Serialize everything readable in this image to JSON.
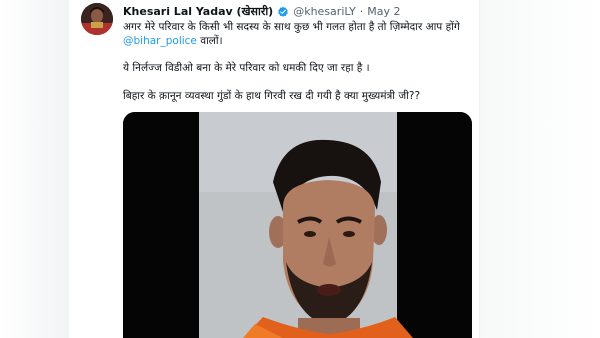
{
  "tweet": {
    "author_name": "Khesari Lal Yadav (खेसारी)",
    "handle": "@khesariLY",
    "separator": "·",
    "date": "May 2",
    "line1": "अगर मेरे परिवार के किसी भी सदस्य के साथ कुछ भी गलत होता है तो ज़िम्मेदार आप होंगे",
    "mention": "@bihar_police",
    "line2_suffix": " वालों।",
    "line3": "ये निर्लज्ज विडीओ बना के मेरे परिवार को धमकी दिए जा रहा है ।",
    "line4": "बिहार के क़ानून व्यवस्था गुंडों के हाथ गिरवी रख दी गयी है क्या मुख्यमंत्री जी??",
    "verified_icon": "verified-badge-icon",
    "accent_color": "#1d9bf0"
  }
}
